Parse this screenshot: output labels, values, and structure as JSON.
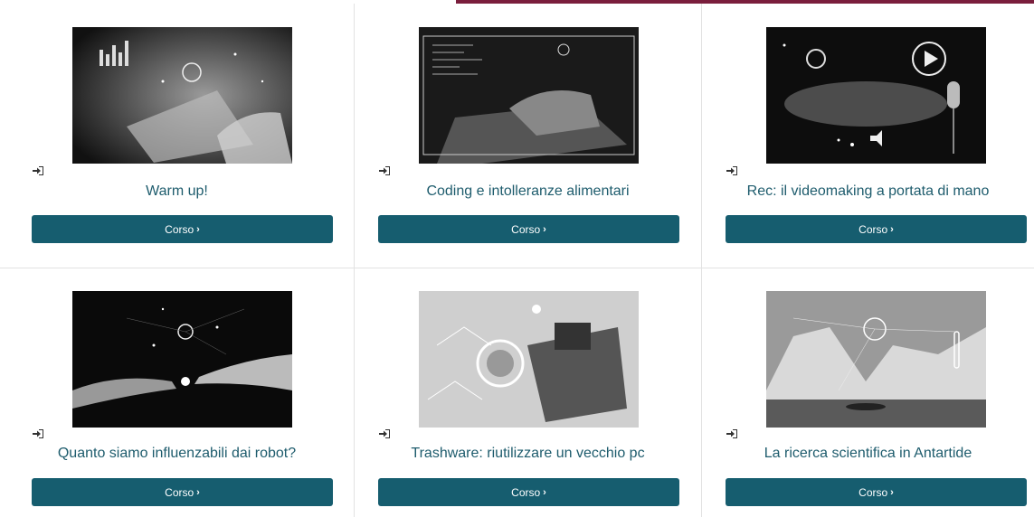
{
  "courses": [
    {
      "title": "Warm up!",
      "button_label": "Corso",
      "chevron": "›",
      "image": "digital-tablet-data-image"
    },
    {
      "title": "Coding e intolleranze alimentari",
      "button_label": "Corso",
      "chevron": "›",
      "image": "coding-laptop-image"
    },
    {
      "title": "Rec: il videomaking a portata di mano",
      "button_label": "Corso",
      "chevron": "›",
      "image": "video-studio-microphone-image"
    },
    {
      "title": "Quanto siamo influenzabili dai robot?",
      "button_label": "Corso",
      "chevron": "›",
      "image": "robot-hand-touch-image"
    },
    {
      "title": "Trashware: riutilizzare un vecchio pc",
      "button_label": "Corso",
      "chevron": "›",
      "image": "recycled-electronics-image"
    },
    {
      "title": "La ricerca scientifica in Antartide",
      "button_label": "Corso",
      "chevron": "›",
      "image": "antarctica-icebergs-image"
    }
  ],
  "colors": {
    "accent_bar": "#7a1e3c",
    "button_bg": "#165d6f",
    "title_text": "#1e5c6d"
  },
  "icons": {
    "enter": "enter-icon"
  }
}
